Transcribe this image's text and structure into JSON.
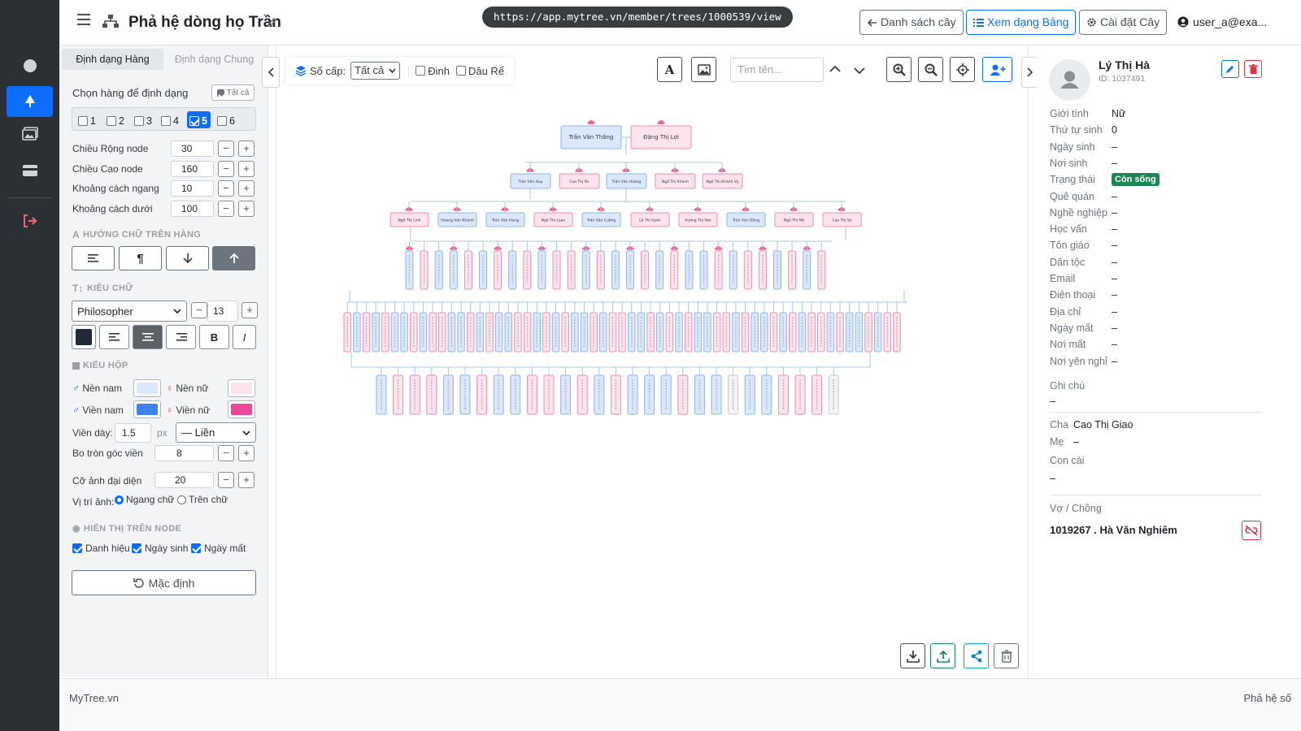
{
  "header": {
    "title": "Phả hệ dòng họ Trần",
    "url": "https://app.mytree.vn/member/trees/1000539/view",
    "btn_list": "Danh sách cây",
    "btn_table": "Xem dạng Bảng",
    "btn_settings": "Cài đặt Cây",
    "user": "user_a@exa..."
  },
  "sidebar": {
    "icons": [
      "circle-icon",
      "tree-icon",
      "images-icon",
      "card-icon",
      "logout-icon"
    ]
  },
  "format_panel": {
    "tabs": [
      "Định dạng Hàng",
      "Định dạng Chung"
    ],
    "choose_rows_label": "Chọn hàng để định dạng",
    "all_label": "Tất cả",
    "rows": [
      {
        "label": "1",
        "checked": false
      },
      {
        "label": "2",
        "checked": false
      },
      {
        "label": "3",
        "checked": false
      },
      {
        "label": "4",
        "checked": false
      },
      {
        "label": "5",
        "checked": true
      },
      {
        "label": "6",
        "checked": false
      }
    ],
    "node_width_label": "Chiều Rộng node",
    "node_width": "30",
    "node_height_label": "Chiều Cao node",
    "node_height": "160",
    "h_gap_label": "Khoảng cách ngang",
    "h_gap": "10",
    "v_gap_label": "Khoảng cách dưới",
    "v_gap": "100",
    "text_direction_title": "HƯỚNG CHỮ TRÊN HÀNG",
    "font_title": "KIỂU CHỮ",
    "font_name": "Philosopher",
    "font_size": "13",
    "bold_label": "B",
    "italic_label": "I",
    "box_title": "KIỂU HỘP",
    "male_bg_label": "Nền nam",
    "female_bg_label": "Nền nữ",
    "male_border_label": "Viền nam",
    "female_border_label": "Viền nữ",
    "male_bg_color": "#dbe8fb",
    "female_bg_color": "#fde3ec",
    "male_border_color": "#3b82f6",
    "female_border_color": "#ec4899",
    "text_color": "#1f2937",
    "border_width_label": "Viền dày:",
    "border_width": "1.5",
    "border_unit": "px",
    "border_style": "— Liền",
    "radius_label": "Bo tròn góc viền",
    "radius": "8",
    "avatar_size_label": "Cỡ ảnh đại diện",
    "avatar_size": "20",
    "avatar_pos_label": "Vị trí ảnh:",
    "avatar_pos_opt1": "Ngang chữ",
    "avatar_pos_opt2": "Trên chữ",
    "display_title": "HIỂN THỊ TRÊN NODE",
    "show_title": "Danh hiệu",
    "show_birth": "Ngày sinh",
    "show_death": "Ngày mất",
    "reset_label": "Mặc định"
  },
  "canvas_toolbar": {
    "level_label": "Số cấp:",
    "level_value": "Tất cả",
    "pin_label": "Đinh",
    "inlaw_label": "Dâu Rể",
    "search_placeholder": "Tìm tên..."
  },
  "tree": {
    "root": [
      {
        "name": "Trần Văn Thắng",
        "gender": "male"
      },
      {
        "name": "Đặng Thị Lợi",
        "gender": "female"
      }
    ],
    "gen2": [
      {
        "name": "Trần Văn Huy",
        "gender": "male"
      },
      {
        "name": "Cao Thị Ân",
        "gender": "female"
      },
      {
        "name": "Trần Văn Hoàng",
        "gender": "male"
      },
      {
        "name": "Ngô Thị Khánh",
        "gender": "female"
      },
      {
        "name": "Ngô Thị Khánh Vy",
        "gender": "female"
      }
    ],
    "gen3": [
      {
        "name": "Ngô Thị Linh",
        "gender": "female"
      },
      {
        "name": "Hoàng Văn Khánh",
        "gender": "male"
      },
      {
        "name": "Trần Văn Hùng",
        "gender": "male"
      },
      {
        "name": "Ngô Thị Loan",
        "gender": "female"
      },
      {
        "name": "Trần Văn Cường",
        "gender": "male"
      },
      {
        "name": "Lê Thị Uyên",
        "gender": "female"
      },
      {
        "name": "Vương Thị Vân",
        "gender": "female"
      },
      {
        "name": "Trần Văn Dũng",
        "gender": "male"
      },
      {
        "name": "Ngô Thị Mỹ",
        "gender": "female"
      },
      {
        "name": "Cao Thị Vy",
        "gender": "female"
      }
    ],
    "gen4_genders": "MFMMFMFMFMFFMFMMFMFMMFMFFMFMF",
    "gen5_genders": "FMFMFMMFMFFMMFMFMMFFMFMFMMFMFFMMFMFMFMMFFMFMMFMFMFFMFMMFMFF",
    "gen6_genders": "MFFFMMFMMFFMFMFMMMFMMGMMFFFG"
  },
  "detail": {
    "name": "Lý Thị Hà",
    "id": "ID: 1037491",
    "fields": [
      {
        "label": "Giới tính",
        "value": "Nữ"
      },
      {
        "label": "Thứ tự sinh",
        "value": "0"
      },
      {
        "label": "Ngày sinh",
        "value": "–"
      },
      {
        "label": "Nơi sinh",
        "value": "–"
      },
      {
        "label": "Trạng thái",
        "value": "Còn sống",
        "badge": true
      },
      {
        "label": "Quê quán",
        "value": "–"
      },
      {
        "label": "Nghề nghiệp",
        "value": "–"
      },
      {
        "label": "Học vấn",
        "value": "–"
      },
      {
        "label": "Tôn giáo",
        "value": "–"
      },
      {
        "label": "Dân tộc",
        "value": "–"
      },
      {
        "label": "Email",
        "value": "–"
      },
      {
        "label": "Điện thoại",
        "value": "–"
      },
      {
        "label": "Địa chỉ",
        "value": "–"
      },
      {
        "label": "Ngày mất",
        "value": "–"
      },
      {
        "label": "Nơi mất",
        "value": "–"
      },
      {
        "label": "Nơi yên nghỉ",
        "value": "–"
      }
    ],
    "note_label": "Ghi chú",
    "note_value": "–",
    "father_label": "Cha",
    "father_value": "Cao Thị Giao",
    "mother_label": "Mẹ",
    "mother_value": "–",
    "children_label": "Con cái",
    "children_value": "–",
    "spouse_label": "Vợ / Chồng",
    "spouse_value": "1019267 . Hà Văn Nghiêm"
  },
  "footer": {
    "left": "MyTree.vn",
    "right": "Phả hệ số"
  }
}
